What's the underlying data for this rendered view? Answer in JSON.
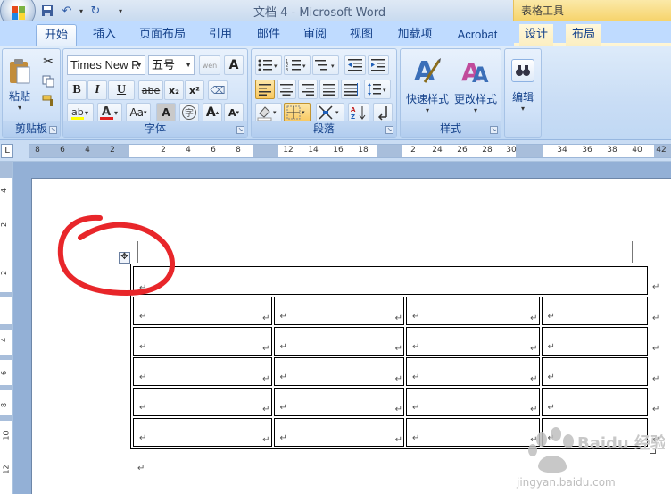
{
  "window": {
    "title": "文档 4 - Microsoft Word",
    "contextual_tab_group": "表格工具"
  },
  "tabs": [
    {
      "label": "开始",
      "active": true
    },
    {
      "label": "插入"
    },
    {
      "label": "页面布局"
    },
    {
      "label": "引用"
    },
    {
      "label": "邮件"
    },
    {
      "label": "审阅"
    },
    {
      "label": "视图"
    },
    {
      "label": "加载项"
    },
    {
      "label": "Acrobat"
    },
    {
      "label": "设计"
    },
    {
      "label": "布局"
    }
  ],
  "ribbon": {
    "clipboard": {
      "label": "剪贴板",
      "paste": "粘贴"
    },
    "font": {
      "label": "字体",
      "font_name": "Times New R",
      "font_size": "五号",
      "bold": "B",
      "italic": "I",
      "underline": "U",
      "strike": "abe",
      "subscript": "x₂",
      "superscript": "x²",
      "case": "Aa",
      "char_border": "A",
      "enclose": "字",
      "grow": "A",
      "shrink": "A",
      "wen": "wén"
    },
    "paragraph": {
      "label": "段落"
    },
    "styles": {
      "label": "样式",
      "quick_styles": "快速样式",
      "change_styles": "更改样式"
    },
    "editing": {
      "label": "编辑"
    }
  },
  "ruler": {
    "numbers": [
      "8",
      "6",
      "4",
      "2",
      "2",
      "4",
      "6",
      "8",
      "12",
      "14",
      "16",
      "18",
      "2",
      "24",
      "26",
      "28",
      "30",
      "34",
      "36",
      "38",
      "40",
      "42"
    ],
    "vnumbers": [
      "4",
      "2",
      "2",
      "4",
      "6",
      "8",
      "10",
      "12"
    ]
  },
  "document": {
    "table_rows": 6,
    "merged_first_row": true,
    "columns": 4
  },
  "watermark": {
    "text": "Baidu 经验",
    "url_text": "jingyan.baidu.com"
  },
  "colors": {
    "ribbon_bg": "#c9ddf5",
    "contextual_tab": "#f6d36a",
    "annotation": "#e8262a"
  }
}
